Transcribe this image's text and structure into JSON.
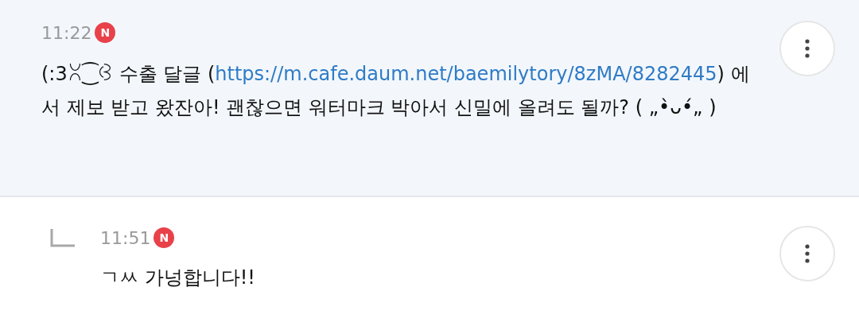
{
  "comments": [
    {
      "kind": "comment",
      "time": "11:22",
      "badge": "N",
      "highlighted": true,
      "parts": [
        {
          "text": "(:3ꇤ⁐ꃳ 수출 달글 (",
          "link": false
        },
        {
          "text": "https://m.cafe.daum.net/baemilytory/8zMA/8282445",
          "link": true
        },
        {
          "text": ") 에서 제보 받고 왔잔아! 괜찮으면 워터마크 박아서 신밀에 올려도 될까? ( „•̀ᴗ•́„ )",
          "link": false
        }
      ]
    },
    {
      "kind": "reply",
      "time": "11:51",
      "badge": "N",
      "highlighted": false,
      "parts": [
        {
          "text": "ㄱㅆ 가넝합니다!!",
          "link": false
        }
      ]
    }
  ]
}
